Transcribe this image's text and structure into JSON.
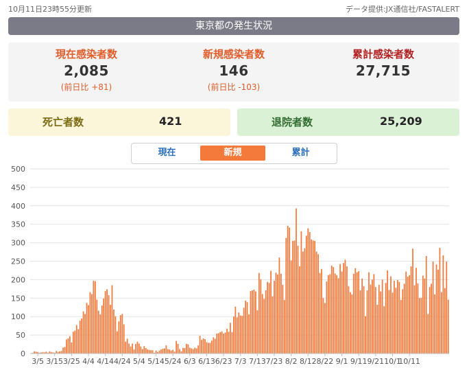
{
  "header": {
    "updated": "10月11日23時55分更新",
    "source": "データ提供:JX通信社/FASTALERT",
    "title": "東京都の発生状況"
  },
  "stats": {
    "current": {
      "label": "現在感染者数",
      "value": "2,085",
      "compare": "(前日比 +81)"
    },
    "new": {
      "label": "新規感染者数",
      "value": "146",
      "compare": "(前日比 -103)"
    },
    "total": {
      "label": "累計感染者数",
      "value": "27,715"
    }
  },
  "deaths": {
    "label": "死亡者数",
    "value": "421"
  },
  "recovered": {
    "label": "退院者数",
    "value": "25,209"
  },
  "tabs": [
    {
      "label": "現在",
      "active": false
    },
    {
      "label": "新規",
      "active": true
    },
    {
      "label": "累計",
      "active": false
    }
  ],
  "colors": {
    "bar": "#f47a3c",
    "bar_edge": "#e0612a",
    "active_tab": "#f47a3c",
    "tab_text": "#2a6fbf"
  },
  "chart_data": {
    "type": "bar",
    "title": "",
    "xlabel": "",
    "ylabel": "",
    "ylim": [
      0,
      500
    ],
    "yticks": [
      "0",
      "50",
      "100",
      "150",
      "200",
      "250",
      "300",
      "350",
      "400",
      "450",
      "500"
    ],
    "xticks": [
      "3/5",
      "3/15",
      "3/25",
      "4/4",
      "4/14",
      "4/24",
      "5/4",
      "5/14",
      "5/24",
      "6/3",
      "6/13",
      "6/23",
      "7/3",
      "7/13",
      "7/23",
      "8/2",
      "8/12",
      "8/22",
      "9/1",
      "9/11",
      "9/21",
      "10/1",
      "10/11"
    ],
    "grid": true,
    "first_date": "3/1",
    "values": [
      1,
      2,
      6,
      5,
      4,
      2,
      3,
      4,
      3,
      5,
      2,
      6,
      4,
      3,
      2,
      7,
      4,
      6,
      7,
      16,
      18,
      38,
      41,
      47,
      30,
      59,
      62,
      77,
      66,
      89,
      95,
      114,
      107,
      137,
      131,
      166,
      161,
      197,
      196,
      146,
      116,
      106,
      130,
      149,
      169,
      174,
      158,
      132,
      185,
      119,
      101,
      60,
      87,
      104,
      107,
      79,
      32,
      40,
      27,
      19,
      27,
      11,
      26,
      32,
      27,
      19,
      12,
      20,
      15,
      11,
      10,
      9,
      9,
      2,
      8,
      4,
      8,
      11,
      13,
      14,
      22,
      12,
      11,
      8,
      10,
      5,
      34,
      26,
      12,
      6,
      15,
      15,
      26,
      25,
      16,
      14,
      12,
      16,
      14,
      22,
      48,
      37,
      41,
      39,
      31,
      29,
      29,
      35,
      44,
      40,
      54,
      55,
      58,
      60,
      54,
      57,
      67,
      59,
      83,
      58,
      100,
      127,
      98,
      111,
      103,
      102,
      124,
      143,
      139,
      106,
      169,
      171,
      173,
      168,
      117,
      218,
      201,
      161,
      148,
      171,
      194,
      191,
      224,
      155,
      197,
      219,
      214,
      260,
      216,
      186,
      145,
      313,
      346,
      341,
      252,
      305,
      306,
      393,
      292,
      236,
      331,
      276,
      285,
      319,
      339,
      329,
      309,
      306,
      305,
      276,
      269,
      218,
      229,
      150,
      137,
      195,
      212,
      215,
      238,
      234,
      217,
      212,
      204,
      242,
      222,
      245,
      254,
      236,
      182,
      166,
      160,
      216,
      231,
      220,
      223,
      171,
      203,
      182,
      101,
      171,
      220,
      187,
      200,
      215,
      180,
      132,
      186,
      168,
      200,
      128,
      191,
      225,
      172,
      209,
      165,
      197,
      178,
      199,
      194,
      145,
      174,
      189,
      222,
      208,
      212,
      236,
      284,
      185,
      232,
      190,
      150,
      151,
      211,
      203,
      264,
      107,
      180,
      189,
      249,
      160,
      241,
      227,
      286,
      166,
      266,
      177,
      249,
      146
    ]
  }
}
